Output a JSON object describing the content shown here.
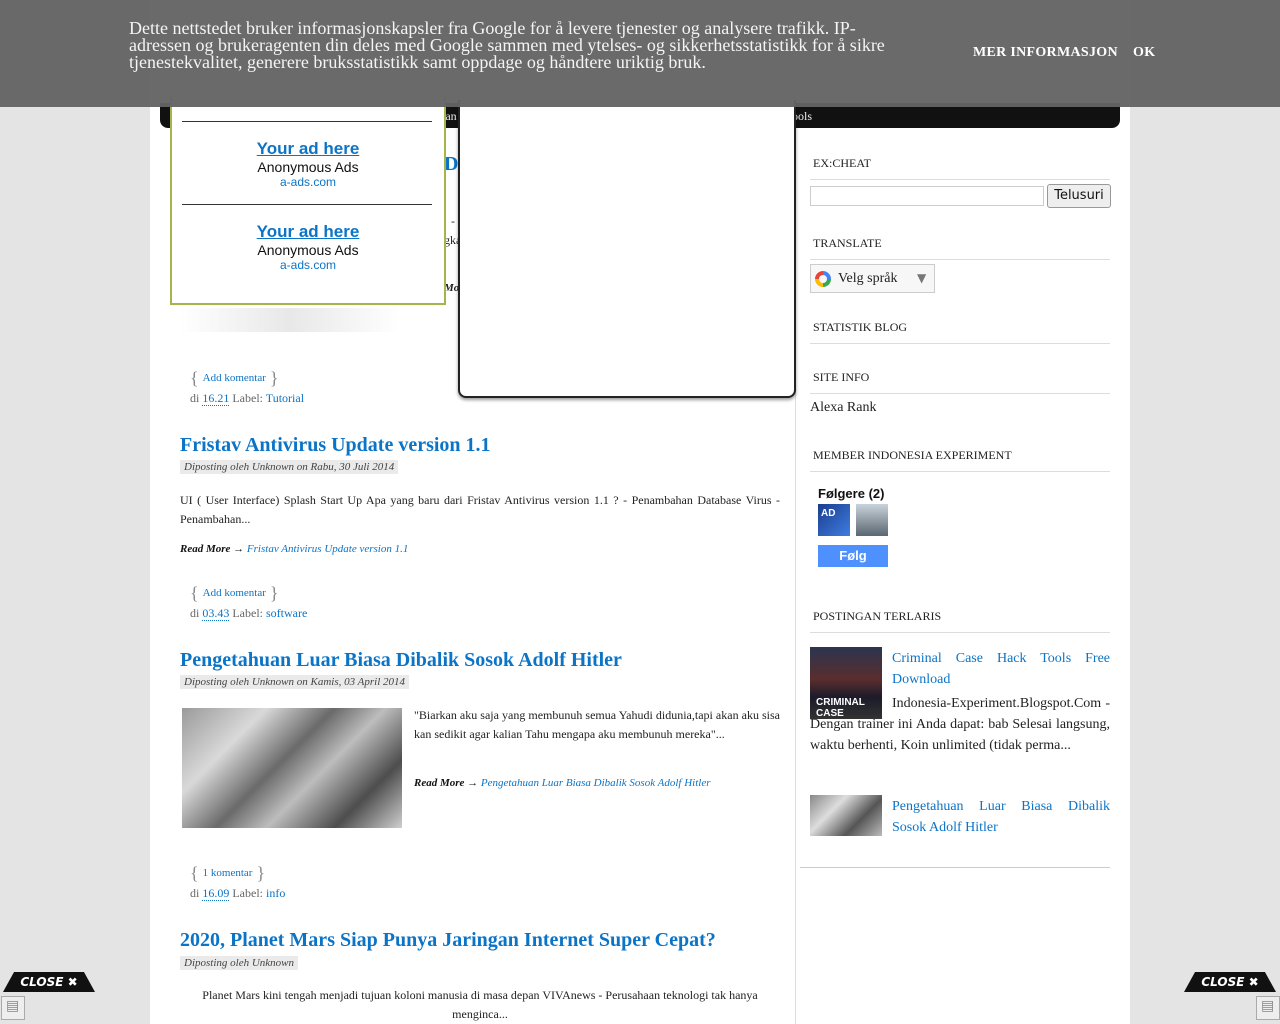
{
  "cookie": {
    "text": "Dette nettstedet bruker informasjonskapsler fra Google for å levere tjenester og analysere trafikk. IP-adressen og brukeragenten din deles med Google sammen med ytelses- og sikkerhetsstatistikk for å sikre tjenestekvalitet, generere bruksstatistikk samt oppdage og håndtere uriktig bruk.",
    "more_label": "MER INFORMASJON",
    "ok_label": "OK"
  },
  "nav": {
    "partial_left": "tan",
    "partial_right": "ools"
  },
  "ad": {
    "slots": [
      {
        "head": "Your ad here",
        "sub": "Anonymous Ads",
        "url": "a-ads.com"
      },
      {
        "head": "Your ad here",
        "sub": "Anonymous Ads",
        "url": "a-ads.com"
      }
    ]
  },
  "posts": {
    "first": {
      "title_partial": "D",
      "body_partial_1": "-",
      "body_partial_2": "gka",
      "readmore_partial": "Mor",
      "comments": "Add komentar",
      "time": "16.21",
      "label_prefix": "Label:",
      "label": "Tutorial",
      "di": "di"
    },
    "fristav": {
      "title": "Fristav Antivirus Update version 1.1",
      "meta": "Diposting oleh Unknown on Rabu, 30 Juli 2014",
      "body": "UI ( User Interface) Splash Start Up Apa yang baru dari Fristav Antivirus version 1.1 ? - Penambahan Database Virus - Penambahan...",
      "readmore": "Read More",
      "readmore_link": "Fristav Antivirus Update version 1.1",
      "comments": "Add komentar",
      "time": "03.43",
      "label": "software"
    },
    "hitler": {
      "title": "Pengetahuan Luar Biasa Dibalik Sosok Adolf Hitler",
      "meta": "Diposting oleh Unknown on Kamis, 03 April 2014",
      "body": "\"Biarkan aku saja yang membunuh semua Yahudi didunia,tapi akan aku sisa kan sedikit agar kalian Tahu mengapa aku membunuh mereka\"...",
      "readmore": "Read More",
      "readmore_link": "Pengetahuan Luar Biasa Dibalik Sosok Adolf Hitler",
      "comments": "1 komentar",
      "time": "16.09",
      "label": "info"
    },
    "mars": {
      "title": "2020, Planet Mars Siap Punya Jaringan Internet Super Cepat?",
      "meta": "Diposting oleh Unknown",
      "body": "Planet Mars kini tengah menjadi tujuan koloni manusia di masa depan VIVAnews  - Perusahaan teknologi tak hanya menginca..."
    }
  },
  "sidebar": {
    "excheat_title": "EX:CHEAT",
    "search_button": "Telusuri",
    "translate_title": "TRANSLATE",
    "translate_label": "Velg språk",
    "translate_arrow": "▼",
    "stat_title": "STATISTIK BLOG",
    "siteinfo_title": "SITE INFO",
    "alexa": "Alexa Rank",
    "member_title": "MEMBER INDONESIA EXPERIMENT",
    "followers": "Følgere (2)",
    "follow_button": "Følg",
    "avatar1_text": "AD",
    "popular_title": "POSTINGAN TERLARIS",
    "popular": [
      {
        "title": "Criminal Case Hack Tools Free Download",
        "thumb_text": "CRIMINAL CASE",
        "snippet": "Indonesia-Experiment.Blogspot.Com - Dengan trainer ini Anda dapat: bab Selesai langsung, waktu berhenti, Koin unlimited (tidak perma..."
      },
      {
        "title": "Pengetahuan Luar Biasa Dibalik Sosok Adolf Hitler"
      }
    ]
  },
  "close": {
    "label": "CLOSE ✖"
  },
  "colors": {
    "link": "#0b74c7",
    "banner": "#646464",
    "ad_border": "#a5b54a",
    "follow": "#4d90fe"
  }
}
